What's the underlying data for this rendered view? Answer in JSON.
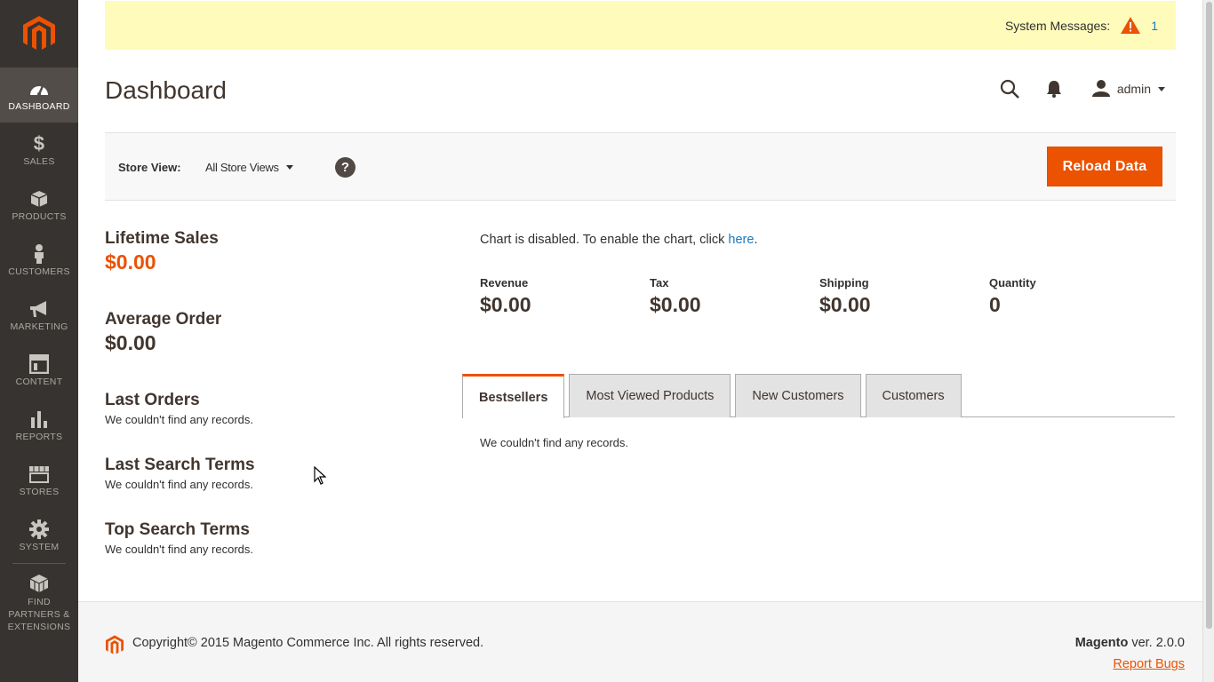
{
  "sidebar": {
    "items": [
      {
        "label": "DASHBOARD",
        "icon": "dashboard-icon"
      },
      {
        "label": "SALES",
        "icon": "dollar-icon"
      },
      {
        "label": "PRODUCTS",
        "icon": "cube-icon"
      },
      {
        "label": "CUSTOMERS",
        "icon": "person-icon"
      },
      {
        "label": "MARKETING",
        "icon": "megaphone-icon"
      },
      {
        "label": "CONTENT",
        "icon": "layout-icon"
      },
      {
        "label": "REPORTS",
        "icon": "bar-chart-icon"
      },
      {
        "label": "STORES",
        "icon": "store-icon"
      },
      {
        "label": "SYSTEM",
        "icon": "gear-icon"
      },
      {
        "label": "FIND PARTNERS & EXTENSIONS",
        "icon": "boxes-icon"
      }
    ]
  },
  "system_messages": {
    "label": "System Messages:",
    "count": "1"
  },
  "header": {
    "title": "Dashboard",
    "user": "admin"
  },
  "store_view": {
    "label": "Store View:",
    "selected": "All Store Views",
    "help": "?",
    "reload_label": "Reload Data"
  },
  "stats": {
    "lifetime_sales": {
      "title": "Lifetime Sales",
      "value": "$0.00"
    },
    "average_order": {
      "title": "Average Order",
      "value": "$0.00"
    },
    "last_orders": {
      "title": "Last Orders",
      "empty": "We couldn't find any records."
    },
    "last_search_terms": {
      "title": "Last Search Terms",
      "empty": "We couldn't find any records."
    },
    "top_search_terms": {
      "title": "Top Search Terms",
      "empty": "We couldn't find any records."
    }
  },
  "chart": {
    "message": "Chart is disabled. To enable the chart, click ",
    "link": "here",
    "period": "."
  },
  "totals": [
    {
      "label": "Revenue",
      "value": "$0.00"
    },
    {
      "label": "Tax",
      "value": "$0.00"
    },
    {
      "label": "Shipping",
      "value": "$0.00"
    },
    {
      "label": "Quantity",
      "value": "0"
    }
  ],
  "tabs": [
    {
      "label": "Bestsellers"
    },
    {
      "label": "Most Viewed Products"
    },
    {
      "label": "New Customers"
    },
    {
      "label": "Customers"
    }
  ],
  "tab_content": {
    "empty": "We couldn't find any records."
  },
  "footer": {
    "copyright": "Copyright© 2015 Magento Commerce Inc. All rights reserved.",
    "brand": "Magento",
    "version": " ver. 2.0.0",
    "report_bugs": "Report Bugs"
  },
  "colors": {
    "accent": "#eb5202",
    "sidebar": "#373330",
    "link": "#1979c3",
    "message_bg": "#fffbbb"
  }
}
